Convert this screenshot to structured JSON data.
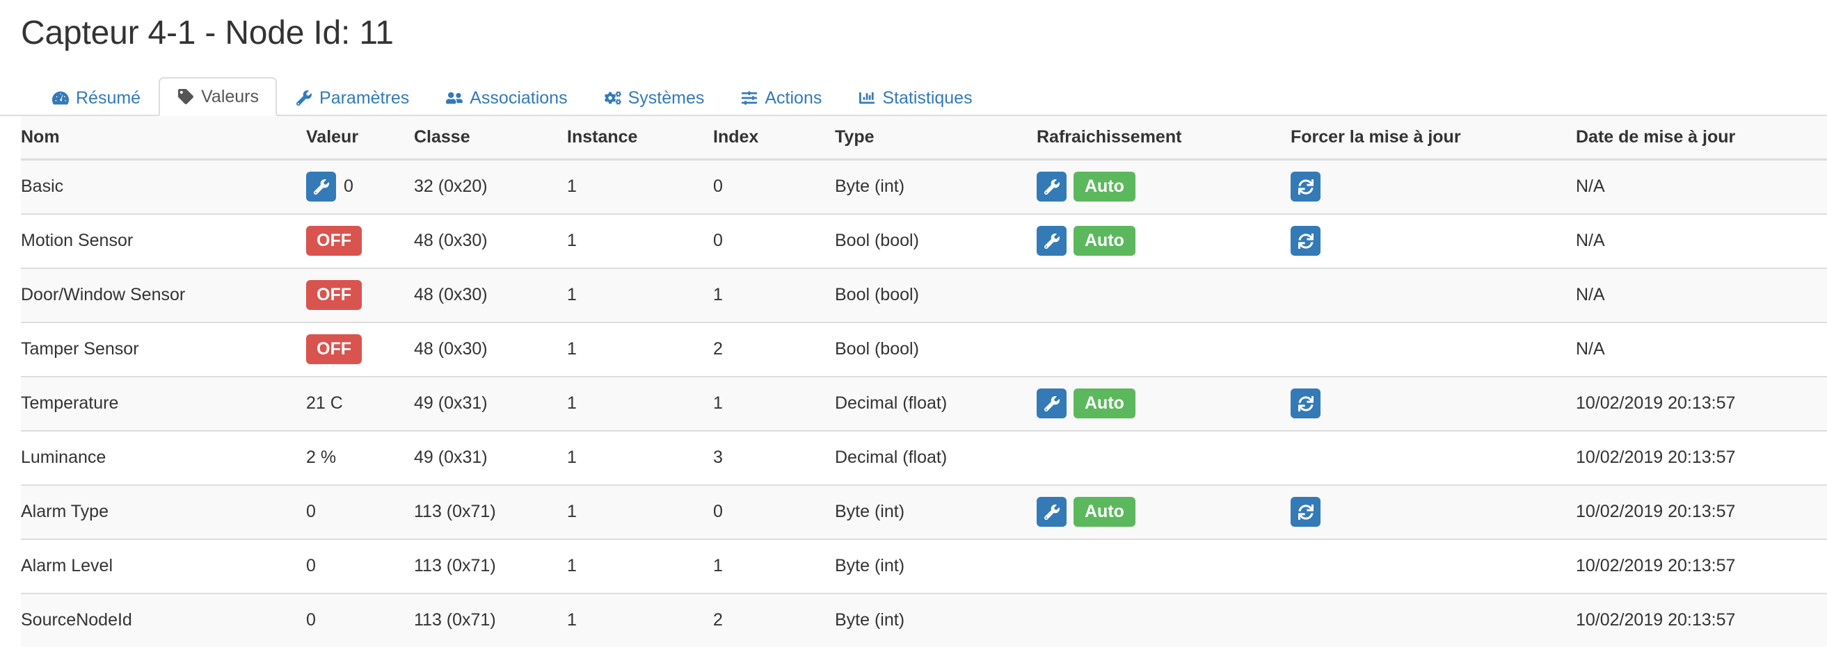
{
  "header": {
    "title": "Capteur 4-1 - Node Id: 11"
  },
  "tabs": [
    {
      "label": "Résumé",
      "icon": "tachometer-icon",
      "active": false
    },
    {
      "label": "Valeurs",
      "icon": "tag-icon",
      "active": true
    },
    {
      "label": "Paramètres",
      "icon": "wrench-icon",
      "active": false
    },
    {
      "label": "Associations",
      "icon": "users-icon",
      "active": false
    },
    {
      "label": "Systèmes",
      "icon": "cogs-icon",
      "active": false
    },
    {
      "label": "Actions",
      "icon": "sliders-icon",
      "active": false
    },
    {
      "label": "Statistiques",
      "icon": "bar-chart-icon",
      "active": false
    }
  ],
  "colors": {
    "primary": "#337ab7",
    "success": "#5cb85c",
    "danger": "#d9534f",
    "link": "#337ab7",
    "stripe": "#f9f9f9",
    "border": "#dddddd"
  },
  "table": {
    "columns": [
      "Nom",
      "Valeur",
      "Classe",
      "Instance",
      "Index",
      "Type",
      "Rafraichissement",
      "Forcer la mise à jour",
      "Date de mise à jour"
    ],
    "labels": {
      "auto": "Auto",
      "off": "OFF",
      "na": "N/A"
    },
    "rows": [
      {
        "nom": "Basic",
        "valeur": "0",
        "valeur_kind": "wrench-value",
        "classe": "32 (0x20)",
        "instance": "1",
        "index": "0",
        "type": "Byte (int)",
        "refresh": true,
        "refresh_label": "Auto",
        "force": true,
        "date": "N/A"
      },
      {
        "nom": "Motion Sensor",
        "valeur": "OFF",
        "valeur_kind": "badge-off",
        "classe": "48 (0x30)",
        "instance": "1",
        "index": "0",
        "type": "Bool (bool)",
        "refresh": true,
        "refresh_label": "Auto",
        "force": true,
        "date": "N/A"
      },
      {
        "nom": "Door/Window Sensor",
        "valeur": "OFF",
        "valeur_kind": "badge-off",
        "classe": "48 (0x30)",
        "instance": "1",
        "index": "1",
        "type": "Bool (bool)",
        "refresh": false,
        "refresh_label": "",
        "force": false,
        "date": "N/A"
      },
      {
        "nom": "Tamper Sensor",
        "valeur": "OFF",
        "valeur_kind": "badge-off",
        "classe": "48 (0x30)",
        "instance": "1",
        "index": "2",
        "type": "Bool (bool)",
        "refresh": false,
        "refresh_label": "",
        "force": false,
        "date": "N/A"
      },
      {
        "nom": "Temperature",
        "valeur": "21 C",
        "valeur_kind": "text",
        "classe": "49 (0x31)",
        "instance": "1",
        "index": "1",
        "type": "Decimal (float)",
        "refresh": true,
        "refresh_label": "Auto",
        "force": true,
        "date": "10/02/2019 20:13:57"
      },
      {
        "nom": "Luminance",
        "valeur": "2 %",
        "valeur_kind": "text",
        "classe": "49 (0x31)",
        "instance": "1",
        "index": "3",
        "type": "Decimal (float)",
        "refresh": false,
        "refresh_label": "",
        "force": false,
        "date": "10/02/2019 20:13:57"
      },
      {
        "nom": "Alarm Type",
        "valeur": "0",
        "valeur_kind": "text",
        "classe": "113 (0x71)",
        "instance": "1",
        "index": "0",
        "type": "Byte (int)",
        "refresh": true,
        "refresh_label": "Auto",
        "force": true,
        "date": "10/02/2019 20:13:57"
      },
      {
        "nom": "Alarm Level",
        "valeur": "0",
        "valeur_kind": "text",
        "classe": "113 (0x71)",
        "instance": "1",
        "index": "1",
        "type": "Byte (int)",
        "refresh": false,
        "refresh_label": "",
        "force": false,
        "date": "10/02/2019 20:13:57"
      },
      {
        "nom": "SourceNodeId",
        "valeur": "0",
        "valeur_kind": "text",
        "classe": "113 (0x71)",
        "instance": "1",
        "index": "2",
        "type": "Byte (int)",
        "refresh": false,
        "refresh_label": "",
        "force": false,
        "date": "10/02/2019 20:13:57"
      }
    ]
  }
}
